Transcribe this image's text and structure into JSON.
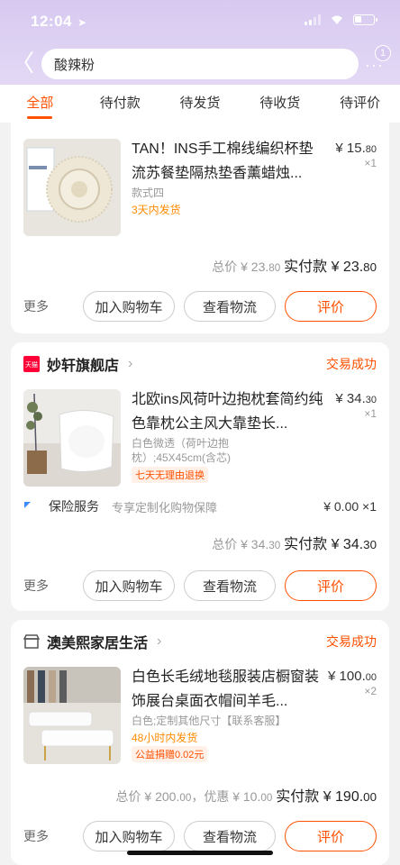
{
  "status_bar": {
    "time": "12:04"
  },
  "header": {
    "search_text": "酸辣粉",
    "badge_count": "1",
    "more_dots": "···"
  },
  "tabs": [
    {
      "label": "全部",
      "active": true
    },
    {
      "label": "待付款"
    },
    {
      "label": "待发货"
    },
    {
      "label": "待收货"
    },
    {
      "label": "待评价"
    }
  ],
  "orders": [
    {
      "title": "TAN！INS手工棉线编织杯垫流苏餐垫隔热垫香薰蜡烛...",
      "price_main": "¥ 15.",
      "price_dec": "80",
      "qty": "×1",
      "spec": "款式四",
      "shipping": "3天内发货",
      "total_label": "总价",
      "total_main": "¥ 23.",
      "total_dec": "80",
      "paid_label": "实付款",
      "paid_main": "¥ 23.",
      "paid_dec": "80",
      "actions": {
        "more": "更多",
        "cart": "加入购物车",
        "logistics": "查看物流",
        "review": "评价"
      }
    },
    {
      "shop_name": "妙轩旗舰店",
      "shop_logo": "天猫",
      "status": "交易成功",
      "title": "北欧ins风荷叶边抱枕套简约纯色靠枕公主风大靠垫长...",
      "price_main": "¥ 34.",
      "price_dec": "30",
      "qty": "×1",
      "spec": "白色微透（荷叶边抱枕）;45X45cm(含芯)",
      "tag": "七天无理由退换",
      "service_label": "保险服务",
      "service_desc": "专享定制化购物保障",
      "service_price": "¥ 0.00 ×1",
      "total_label": "总价",
      "total_main": "¥ 34.",
      "total_dec": "30",
      "paid_label": "实付款",
      "paid_main": "¥ 34.",
      "paid_dec": "30",
      "actions": {
        "more": "更多",
        "cart": "加入购物车",
        "logistics": "查看物流",
        "review": "评价"
      }
    },
    {
      "shop_name": "澳美熙家居生活",
      "status": "交易成功",
      "title": "白色长毛绒地毯服装店橱窗装饰展台桌面衣帽间羊毛...",
      "price_main": "¥ 100.",
      "price_dec": "00",
      "qty": "×2",
      "spec": "白色;定制其他尺寸【联系客服】",
      "shipping": "48小时内发货",
      "tag": "公益捐赠0.02元",
      "total_label": "总价",
      "total_main": "¥ 200.",
      "total_dec": "00",
      "discount_label": "，优惠",
      "discount_main": "¥ 10.",
      "discount_dec": "00",
      "paid_label": "实付款",
      "paid_main": "¥ 190.",
      "paid_dec": "00",
      "actions": {
        "more": "更多",
        "cart": "加入购物车",
        "logistics": "查看物流",
        "review": "评价"
      }
    }
  ],
  "colors": {
    "accent": "#ff5000",
    "header_bg": "#d7c9f0",
    "ship_color": "#ff8a00"
  }
}
